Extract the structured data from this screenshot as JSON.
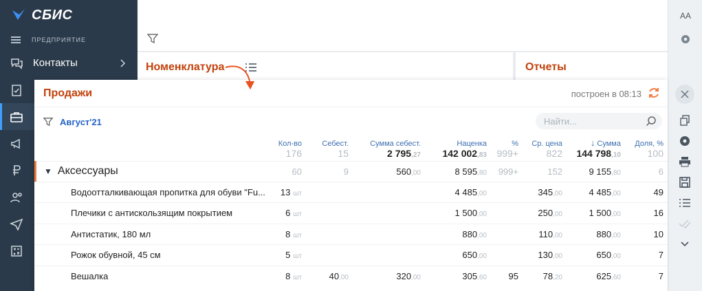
{
  "app": {
    "name": "СБИС",
    "company": "ПРЕДПРИЯТИЕ"
  },
  "sidebar": {
    "items": [
      {
        "label": "Контакты",
        "icon": "contacts-icon"
      }
    ]
  },
  "cards": {
    "nomenclature": "Номенклатура",
    "reports": "Отчеты"
  },
  "panel": {
    "title": "Продажи",
    "built": "построен в 08:13",
    "period": "Август'21",
    "search_placeholder": "Найти..."
  },
  "table": {
    "headers": [
      "Кол-во",
      "Себест.",
      "Сумма себест.",
      "Наценка",
      "%",
      "Ср. цена",
      "Сумма",
      "Доля, %"
    ],
    "sort_arrow": "↓",
    "totals": {
      "qty": "176",
      "cost": "15",
      "cost_sum": "2 795",
      "cost_sum_kop": ",27",
      "markup": "142 002",
      "markup_kop": ",83",
      "pct": "999+",
      "avg": "822",
      "sum": "144 798",
      "sum_kop": ",10",
      "share": "100"
    },
    "group": {
      "name": "Аксессуары",
      "qty": "60",
      "cost": "9",
      "cost_sum": "560",
      "cost_sum_kop": ",00",
      "markup": "8 595",
      "markup_kop": ",80",
      "pct": "999+",
      "avg": "152",
      "sum": "9 155",
      "sum_kop": ",80",
      "share": "6"
    },
    "rows": [
      {
        "name": "Водоотталкивающая пропитка для обуви \"Fu...",
        "qty": "13",
        "unit": "шт",
        "cost": "",
        "cost_kop": "",
        "cost_sum": "",
        "cost_sum_kop": "",
        "markup": "4 485",
        "markup_kop": ",00",
        "pct": "",
        "avg": "345",
        "avg_kop": ",00",
        "sum": "4 485",
        "sum_kop": ",00",
        "share": "49"
      },
      {
        "name": "Плечики с антискользящим покрытием",
        "qty": "6",
        "unit": "шт",
        "cost": "",
        "cost_kop": "",
        "cost_sum": "",
        "cost_sum_kop": "",
        "markup": "1 500",
        "markup_kop": ",00",
        "pct": "",
        "avg": "250",
        "avg_kop": ",00",
        "sum": "1 500",
        "sum_kop": ",00",
        "share": "16"
      },
      {
        "name": "Антистатик, 180 мл",
        "qty": "8",
        "unit": "шт",
        "cost": "",
        "cost_kop": "",
        "cost_sum": "",
        "cost_sum_kop": "",
        "markup": "880",
        "markup_kop": ",00",
        "pct": "",
        "avg": "110",
        "avg_kop": ",00",
        "sum": "880",
        "sum_kop": ",00",
        "share": "10"
      },
      {
        "name": "Рожок обувной, 45 см",
        "qty": "5",
        "unit": "шт",
        "cost": "",
        "cost_kop": "",
        "cost_sum": "",
        "cost_sum_kop": "",
        "markup": "650",
        "markup_kop": ",00",
        "pct": "",
        "avg": "130",
        "avg_kop": ",00",
        "sum": "650",
        "sum_kop": ",00",
        "share": "7"
      },
      {
        "name": "Вешалка",
        "qty": "8",
        "unit": "шт",
        "cost": "40",
        "cost_kop": ",00",
        "cost_sum": "320",
        "cost_sum_kop": ",00",
        "markup": "305",
        "markup_kop": ",60",
        "pct": "95",
        "avg": "78",
        "avg_kop": ",20",
        "sum": "625",
        "sum_kop": ",60",
        "share": "7"
      }
    ]
  },
  "toolbar": {
    "font_label": "АА"
  },
  "colors": {
    "accent_orange": "#c2410c",
    "link_blue": "#2563c9",
    "sidebar_bg": "#2b3a4a"
  }
}
